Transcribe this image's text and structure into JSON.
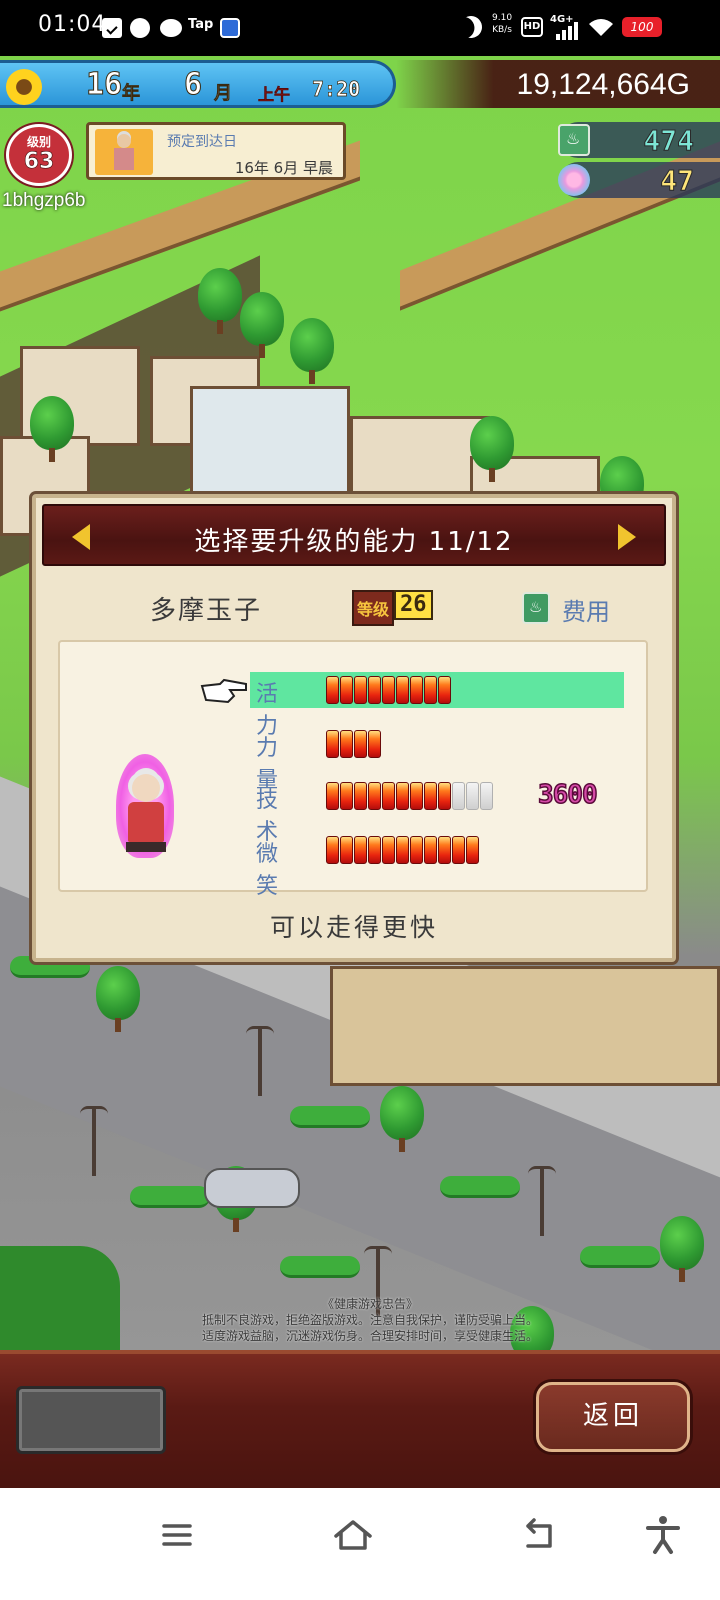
{
  "status_bar": {
    "time": "01:04",
    "net_speed_value": "9.10",
    "net_speed_unit": "KB/s",
    "hd": "HD",
    "network": "4G+",
    "battery": "100",
    "tap_label": "Tap"
  },
  "hud": {
    "year": "16",
    "year_unit": "年",
    "month": "6",
    "month_unit": "月",
    "period": "上午",
    "clock": "7:20",
    "gold": "19,124,664G",
    "level_label": "级别",
    "level_value": "63",
    "player_name": "1bhgzp6b",
    "visitor_title": "预定到达日",
    "visitor_date": "16年 6月 早晨",
    "tickets": "474",
    "medals": "47"
  },
  "dialog": {
    "title": "选择要升级的能力 11/12",
    "staff_name": "多摩玉子",
    "level_label": "等级",
    "level_value": "26",
    "cost_label": "费用",
    "upgrade_cost": "3600",
    "description": "可以走得更快",
    "stats": [
      {
        "name": "活力",
        "filled": 9,
        "empty": 0,
        "selected": true
      },
      {
        "name": "力量",
        "filled": 4,
        "empty": 0,
        "selected": false
      },
      {
        "name": "技术",
        "filled": 9,
        "empty": 3,
        "selected": false
      },
      {
        "name": "微笑",
        "filled": 11,
        "empty": 0,
        "selected": false
      }
    ]
  },
  "notice": {
    "line1": "《健康游戏忠告》",
    "line2": "抵制不良游戏，拒绝盗版游戏。注意自我保护，谨防受骗上当。",
    "line3": "适度游戏益脑，沉迷游戏伤身。合理安排时间，享受健康生活。"
  },
  "bottom": {
    "back_label": "返回"
  },
  "colors": {
    "header_bg": "#4a1311",
    "panel_bg": "#efe5cc",
    "selected_row": "#5fe6a0",
    "stat_name": "#5a7bb0",
    "cost_color": "#d64aa8"
  },
  "icons": {
    "doc": "checklist-icon",
    "speed": "speedometer-icon",
    "chat": "wechat-icon",
    "app": "app-icon",
    "moon": "do-not-disturb-icon",
    "wifi": "wifi-icon",
    "sunflower": "sunflower-icon",
    "ticket": "hot-spring-ticket-icon",
    "medal": "medal-icon",
    "pointer": "pointing-hand-icon"
  }
}
